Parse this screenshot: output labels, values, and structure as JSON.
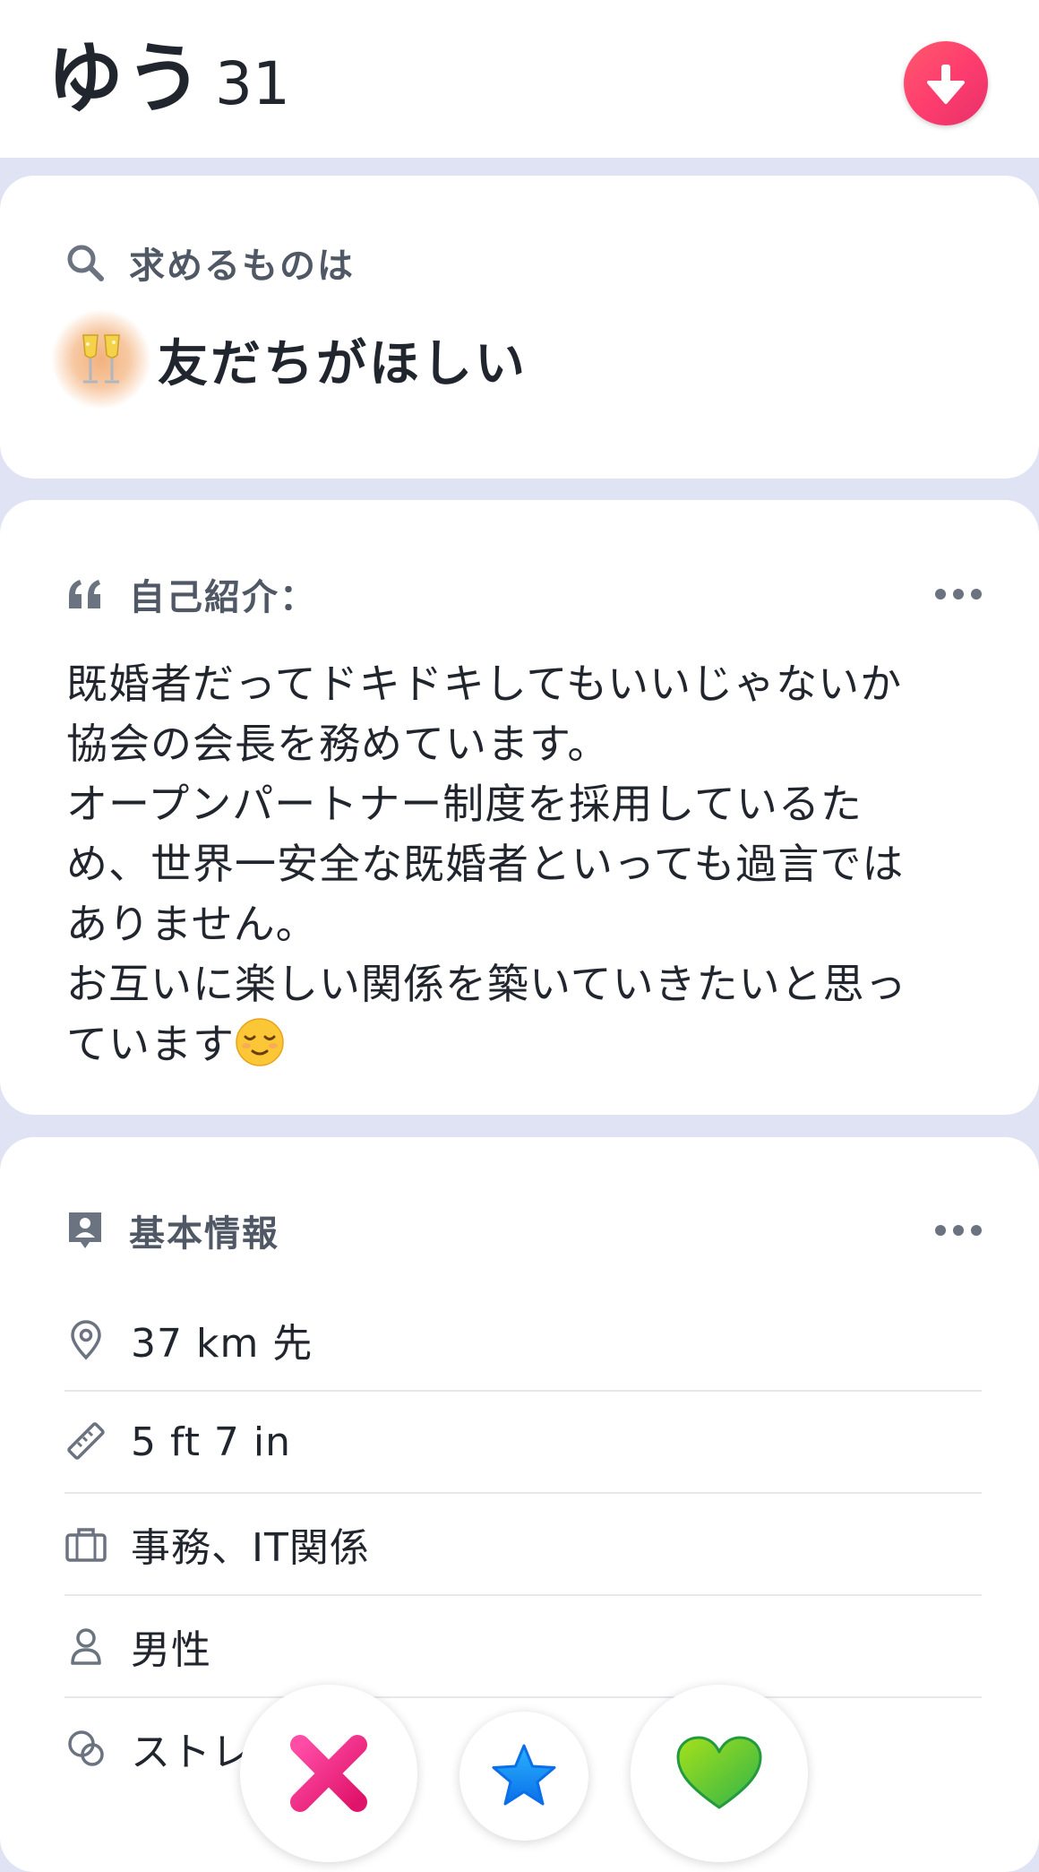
{
  "profile": {
    "name": "ゆう",
    "age": "31"
  },
  "header": {
    "collapse_icon": "arrow-down-icon",
    "collapse_color": "#fd3d6e"
  },
  "looking_for": {
    "title": "求めるものは",
    "icon": "search-icon",
    "value": "友だちがほしい",
    "value_icon": "champagne-glasses-icon"
  },
  "bio": {
    "title": "自己紹介：",
    "icon": "quote-icon",
    "more_icon": "more-dots-icon",
    "lines": [
      "既婚者だってドキドキしてもいいじゃないか",
      "協会の会長を務めています。",
      "オープンパートナー制度を採用しているた",
      "め、世界一安全な既婚者といっても過言では",
      "ありません。",
      "お互いに楽しい関係を築いていきたいと思っ",
      "ています"
    ],
    "end_emoji": "relieved-face-icon"
  },
  "basic_info": {
    "title": "基本情報",
    "icon": "id-card-icon",
    "more_icon": "more-dots-icon",
    "rows": [
      {
        "icon": "location-pin-icon",
        "text": "37 km 先"
      },
      {
        "icon": "ruler-icon",
        "text": "5 ft 7 in"
      },
      {
        "icon": "briefcase-icon",
        "text": "事務、IT関係"
      },
      {
        "icon": "person-icon",
        "text": "男性"
      },
      {
        "icon": "orientation-icon",
        "text": "ストレ"
      }
    ]
  },
  "actions": {
    "nope_icon": "x-icon",
    "super_like_icon": "star-icon",
    "like_icon": "heart-icon"
  },
  "colors": {
    "page_bg": "#dfe3f4",
    "card_bg": "#ffffff",
    "text": "#21262e",
    "secondary_text": "#505865",
    "nope": "#fd267a",
    "super_like": "#1786ff",
    "like": "#6ed000"
  }
}
